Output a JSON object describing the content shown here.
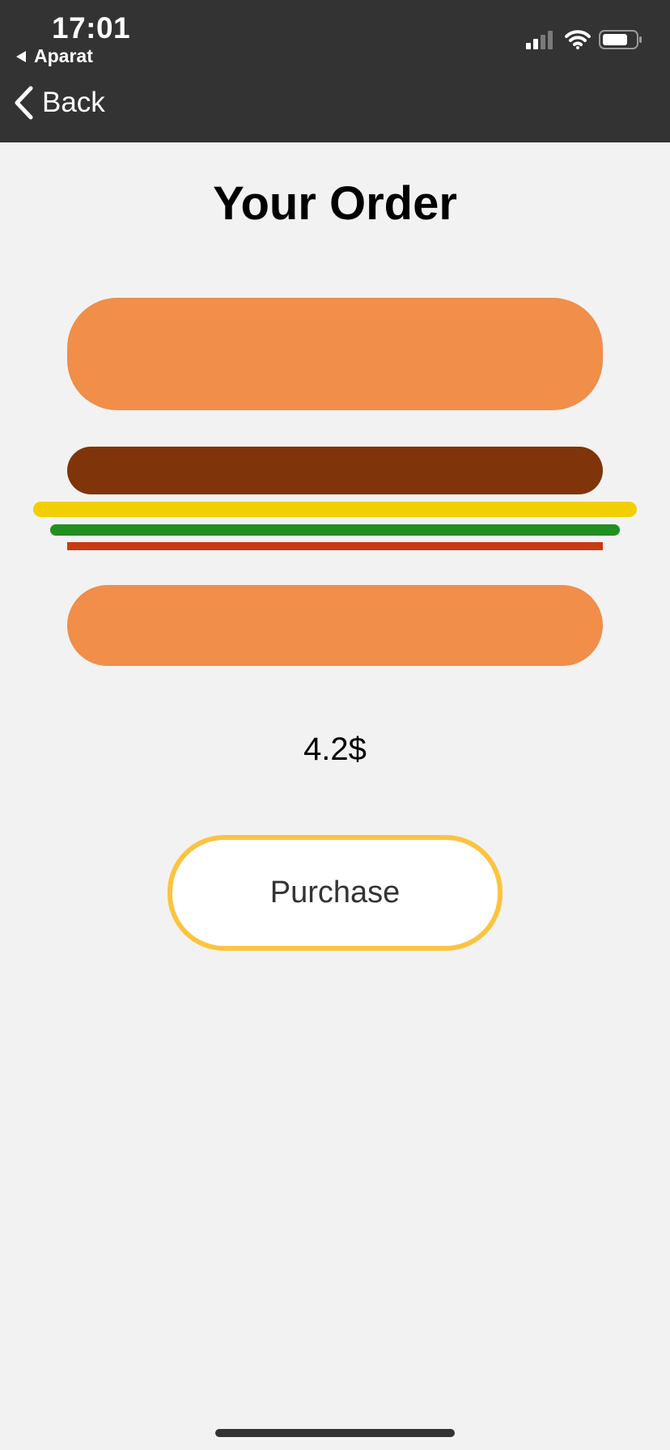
{
  "status_bar": {
    "time": "17:01",
    "back_app": "Aparat",
    "icons": [
      "signal-icon",
      "wifi-icon",
      "battery-icon"
    ]
  },
  "nav": {
    "back_label": "Back"
  },
  "page": {
    "title": "Your Order"
  },
  "burger": {
    "layers": [
      "bun-top",
      "patty",
      "cheese",
      "lettuce",
      "tomato",
      "bun-bottom"
    ],
    "colors": {
      "bun": "#f08e4a",
      "patty": "#7f3409",
      "cheese": "#f2cf00",
      "lettuce": "#219020",
      "tomato": "#c73b13"
    }
  },
  "order": {
    "price": "4.2$",
    "purchase_label": "Purchase"
  },
  "colors": {
    "header_bg": "#333333",
    "page_bg": "#f2f2f2",
    "button_border": "#fbc43f"
  }
}
